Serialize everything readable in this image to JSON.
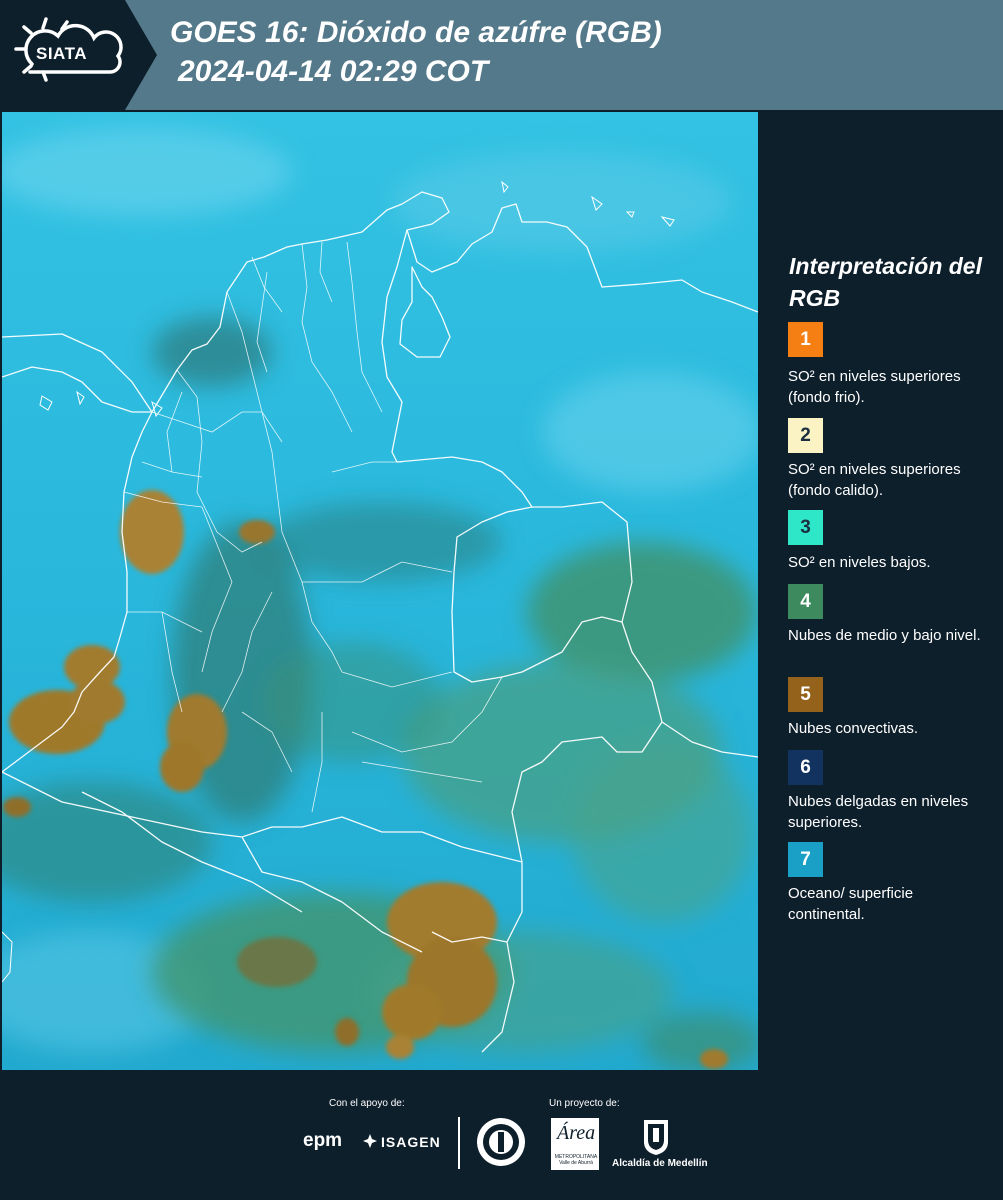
{
  "header": {
    "logo_text": "SIATA",
    "title_line1": "GOES 16: Dióxido de azúfre (RGB)",
    "title_line2": "2024-04-14 02:29 COT"
  },
  "legend": {
    "title": "Interpretación del RGB",
    "items": [
      {
        "number": "1",
        "label": "SO² en niveles superiores (fondo frio).",
        "color": "#f57f13",
        "text_color": "#ffffff"
      },
      {
        "number": "2",
        "label": "SO² en niveles superiores (fondo calido).",
        "color": "#fbf3c4",
        "text_color": "#1b2f40"
      },
      {
        "number": "3",
        "label": "SO² en niveles bajos.",
        "color": "#2ee7c8",
        "text_color": "#1b2f40"
      },
      {
        "number": "4",
        "label": "Nubes de medio y bajo nivel.",
        "color": "#3c8a5e",
        "text_color": "#ffffff"
      },
      {
        "number": "5",
        "label": "Nubes convectivas.",
        "color": "#94621a",
        "text_color": "#ffffff"
      },
      {
        "number": "6",
        "label": "Nubes delgadas en niveles superiores.",
        "color": "#123260",
        "text_color": "#ffffff"
      },
      {
        "number": "7",
        "label": "Oceano/ superficie continental.",
        "color": "#1aa0c6",
        "text_color": "#ffffff"
      }
    ]
  },
  "footer": {
    "support_caption": "Con el apoyo de:",
    "project_caption": "Un proyecto de:",
    "logo_epm": "epm",
    "logo_isagen": "ISAGEN",
    "logo_area": "Área",
    "logo_area_sub": "METROPOLITANA Valle de Aburrá",
    "logo_alcaldia": "Alcaldía de Medellín"
  },
  "colors": {
    "header_bg": "#54798a",
    "panel_bg": "#0e1f2c",
    "map_base": "#2bbde0",
    "cloud_convective": "#9a7a2c",
    "cloud_mid_low": "#3e9a78"
  }
}
